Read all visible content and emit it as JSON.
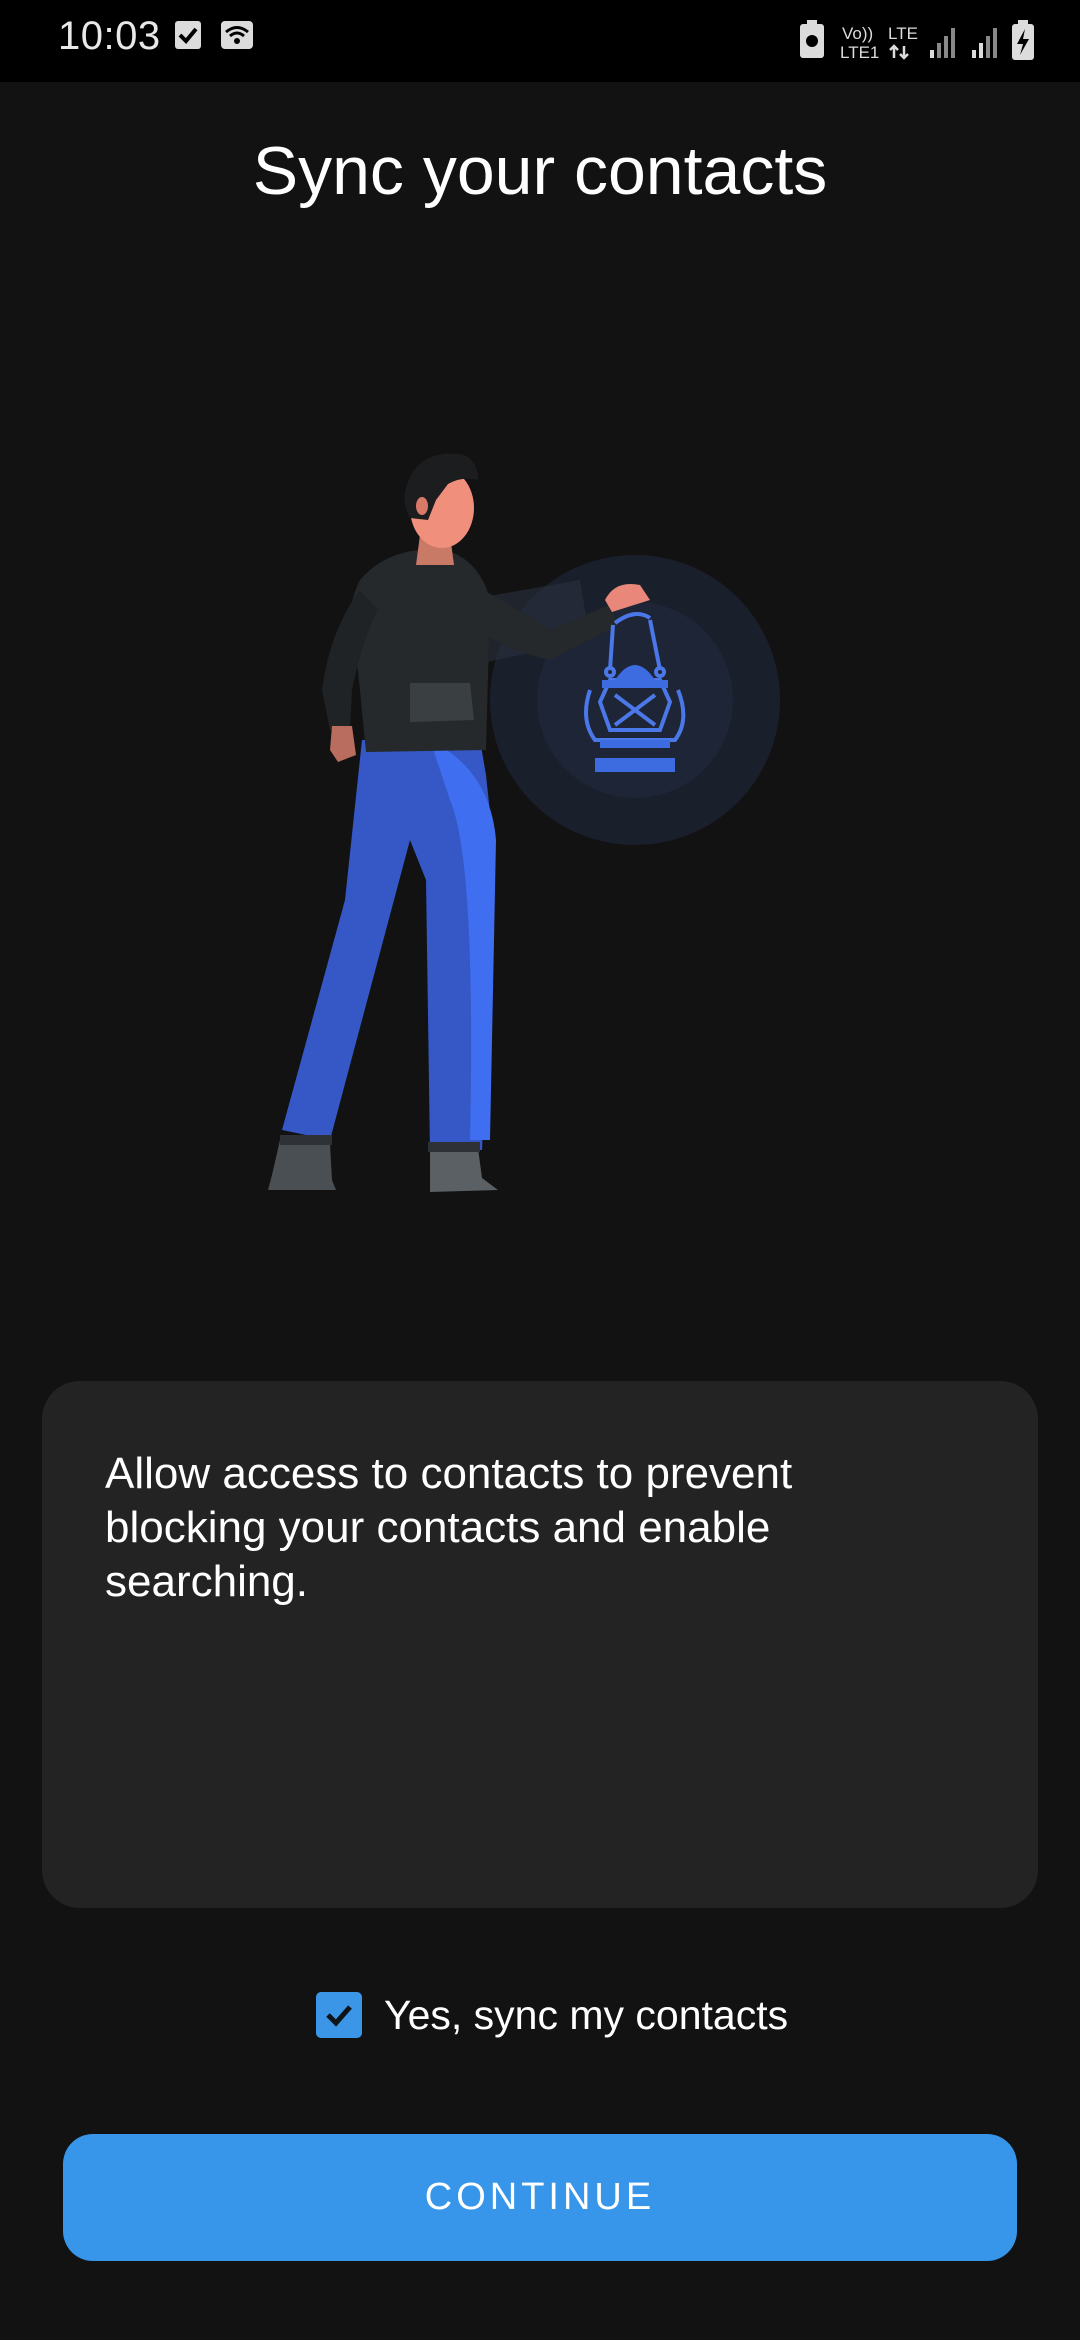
{
  "status_bar": {
    "time": "10:03",
    "network_label_1": "Vo)) LTE",
    "network_label_2": "LTE1",
    "icons": [
      "checkbox-notification-icon",
      "wifi-icon",
      "battery-saver-icon",
      "volte-icon",
      "lte-data-icon",
      "signal-sim1-icon",
      "signal-sim2-icon",
      "battery-charging-icon"
    ]
  },
  "title": "Sync your contacts",
  "info_card": {
    "text": "Allow access to contacts to prevent blocking your contacts and enable searching."
  },
  "sync_option": {
    "label": "Yes, sync my contacts",
    "checked": true
  },
  "continue_button": {
    "label": "CONTINUE"
  },
  "colors": {
    "background": "#121212",
    "card": "#232323",
    "accent": "#3796ea",
    "illustration_blue": "#3d6ce0"
  }
}
